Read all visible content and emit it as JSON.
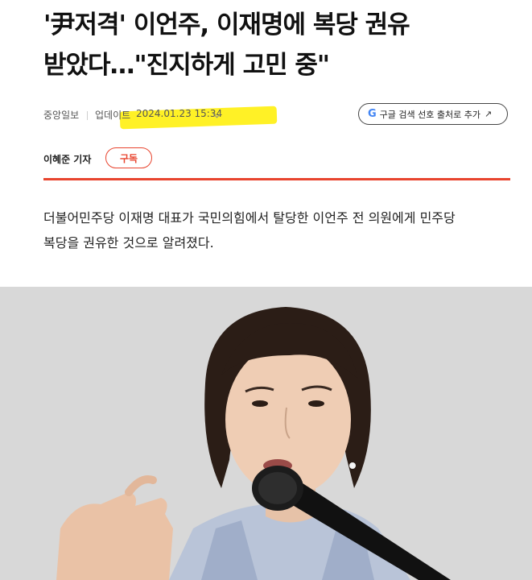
{
  "article": {
    "headline_line1": "'尹저격' 이언주, 이재명에 복당 권유",
    "headline_line2": "받았다…\"진지하게 고민 중\"",
    "source": "중앙일보",
    "update_label": "업데이트",
    "update_time": "2024.01.23 15:34",
    "google_button_label": "구글 검색 선호 출처로 추가",
    "google_logo": "G",
    "author": "이혜준 기자",
    "subscribe_label": "구독",
    "lead_line1": "더불어민주당 이재명 대표가 국민의힘에서 탈당한 이언주 전 의원에게 민주당",
    "lead_line2": "복당을 권유한 것으로 알려졌다."
  },
  "colors": {
    "accent_red": "#e8442e",
    "highlight_yellow": "#ffee00",
    "google_blue": "#4285F4"
  },
  "icons": {
    "update_toggle": "chevron-down-icon",
    "google_button": "arrow-up-right-icon"
  }
}
